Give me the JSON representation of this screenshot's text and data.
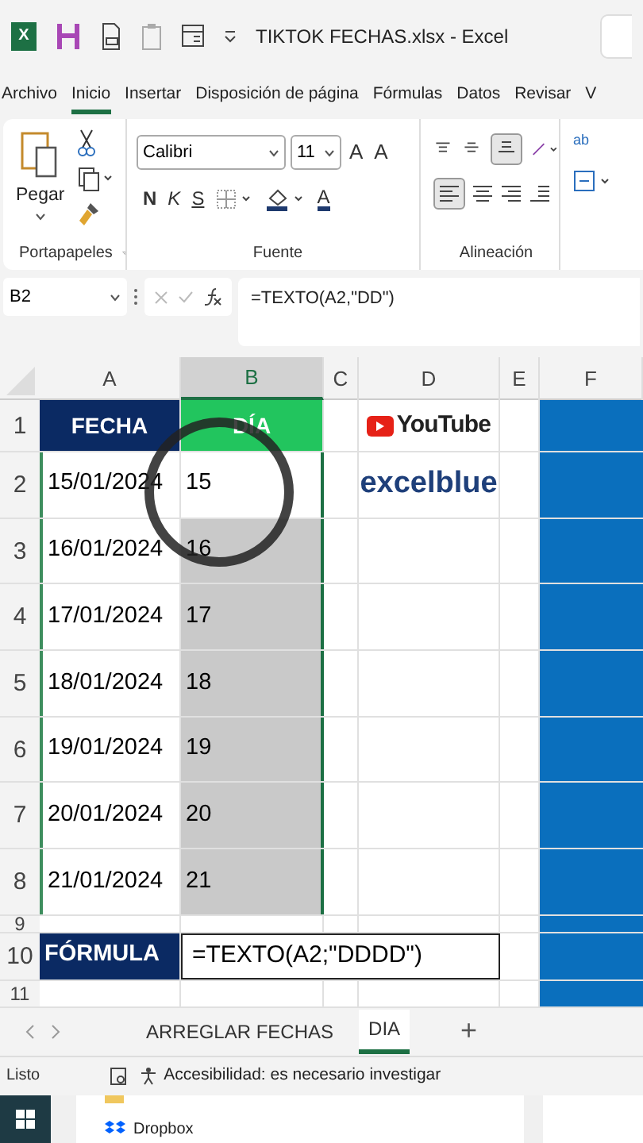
{
  "title_bar": {
    "app_letter": "X",
    "title": "TIKTOK FECHAS.xlsx  -  Excel"
  },
  "menu_tabs": [
    {
      "label": "Archivo",
      "selected": false
    },
    {
      "label": "Inicio",
      "selected": true
    },
    {
      "label": "Insertar",
      "selected": false
    },
    {
      "label": "Disposición de página",
      "selected": false
    },
    {
      "label": "Fórmulas",
      "selected": false
    },
    {
      "label": "Datos",
      "selected": false
    },
    {
      "label": "Revisar",
      "selected": false
    },
    {
      "label": "V",
      "selected": false
    }
  ],
  "ribbon": {
    "paste_label": "Pegar",
    "font_name": "Calibri",
    "font_size": "11",
    "size_buttons": [
      "A",
      "A"
    ],
    "style_buttons": [
      "N",
      "K",
      "S"
    ],
    "font_color_letter": "A",
    "groups": [
      "Portapapeles",
      "Fuente",
      "Alineación"
    ],
    "wrap_label": "ab"
  },
  "formula_bar": {
    "name_box": "B2",
    "formula": "=TEXTO(A2,\"DD\")"
  },
  "columns": [
    {
      "label": "A",
      "selected": false
    },
    {
      "label": "B",
      "selected": true
    },
    {
      "label": "C",
      "selected": false
    },
    {
      "label": "D",
      "selected": false
    },
    {
      "label": "E",
      "selected": false
    },
    {
      "label": "F",
      "selected": false
    }
  ],
  "rows": [
    {
      "number": "1",
      "kind": "header",
      "fecha": "FECHA",
      "dia": "DÍA",
      "logo": "YouTube"
    },
    {
      "number": "2",
      "kind": "data",
      "fecha": "15/01/2024",
      "dia": "15",
      "selected": true,
      "active": true,
      "brand": "excelblue"
    },
    {
      "number": "3",
      "kind": "data",
      "fecha": "16/01/2024",
      "dia": "16",
      "selected": true,
      "active": false
    },
    {
      "number": "4",
      "kind": "data",
      "fecha": "17/01/2024",
      "dia": "17",
      "selected": true,
      "active": false
    },
    {
      "number": "5",
      "kind": "data",
      "fecha": "18/01/2024",
      "dia": "18",
      "selected": true,
      "active": false
    },
    {
      "number": "6",
      "kind": "data",
      "fecha": "19/01/2024",
      "dia": "19",
      "selected": true,
      "active": false
    },
    {
      "number": "7",
      "kind": "data",
      "fecha": "20/01/2024",
      "dia": "20",
      "selected": true,
      "active": false
    },
    {
      "number": "8",
      "kind": "data",
      "fecha": "21/01/2024",
      "dia": "21",
      "selected": true,
      "active": false
    },
    {
      "number": "9",
      "kind": "empty"
    },
    {
      "number": "10",
      "kind": "formula",
      "label": "FÓRMULA",
      "formula": "=TEXTO(A2;\"DDDD\")"
    },
    {
      "number": "11",
      "kind": "empty"
    }
  ],
  "sheet_tabs": [
    {
      "label": "ARREGLAR FECHAS",
      "selected": false
    },
    {
      "label": "DIA",
      "selected": true
    }
  ],
  "add_sheet": "+",
  "status_bar": {
    "ready": "Listo",
    "accessibility": "Accesibilidad: es necesario investigar"
  },
  "taskbar": {
    "folder_item": "Dropbox"
  }
}
